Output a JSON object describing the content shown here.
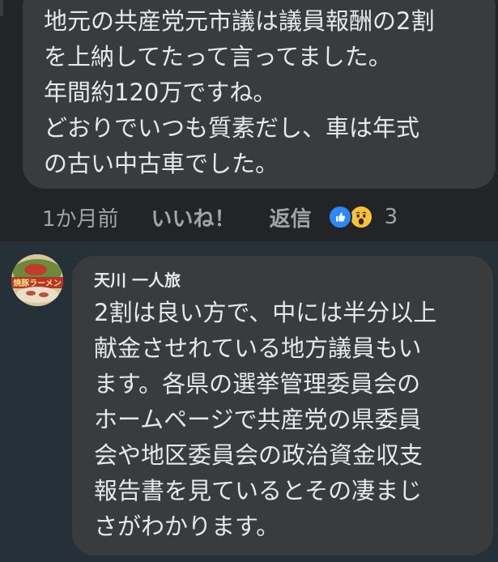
{
  "first_comment": {
    "lines": [
      "地元の共産党元市議は議員報酬の2割",
      "を上納してたって言ってました。",
      "年間約120万ですね。",
      "どおりでいつも質素だし、車は年式",
      "の古い中古車でした。"
    ],
    "time": "1か月前",
    "like_label": "いいね！",
    "reply_label": "返信",
    "reactions": [
      "like-icon",
      "wow-icon"
    ],
    "reaction_count": "3"
  },
  "reply": {
    "author": "天川 一人旅",
    "avatar_text": "焼豚ラーメン",
    "lines": [
      "2割は良い方で、中には半分以上",
      "献金させれている地方議員もい",
      "ます。各県の選挙管理委員会の",
      "ホームページで共産党の県委員",
      "会や地区委員会の政治資金収支",
      "報告書を見ているとその凄まじ",
      "さがわかります。"
    ]
  },
  "colors": {
    "background": "#242526",
    "reply_background": "#263038",
    "bubble": "#3a3b3c",
    "text": "#e6e8eb",
    "secondary_text": "#a0a3a7",
    "like_blue": "#2d88ff",
    "wow_yellow": "#f7c33b"
  }
}
